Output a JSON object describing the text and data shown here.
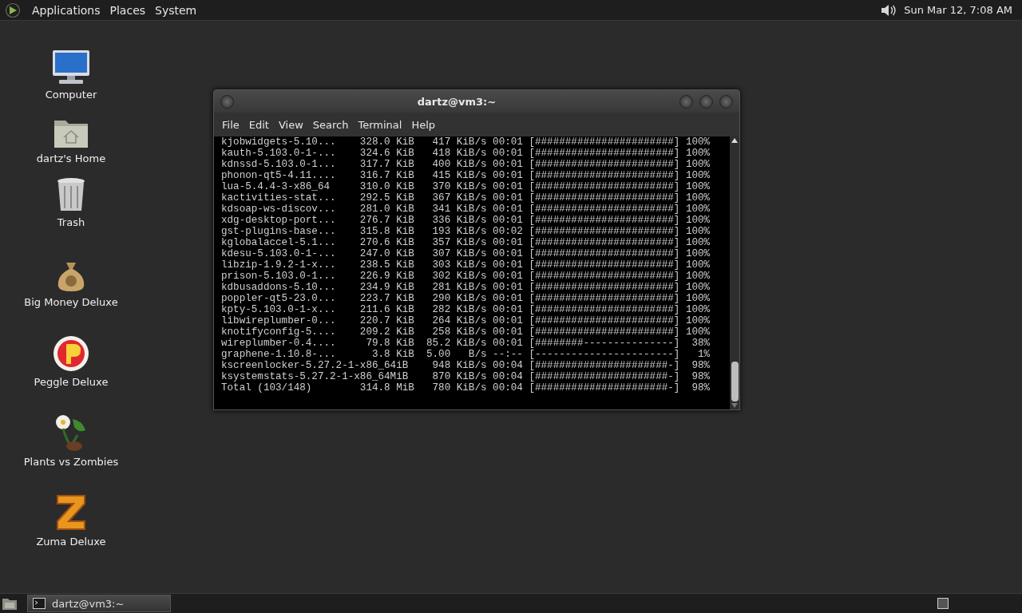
{
  "top_panel": {
    "menus": [
      "Applications",
      "Places",
      "System"
    ],
    "clock": "Sun Mar 12, 7:08 AM"
  },
  "desktop_icons": [
    {
      "label": "Computer",
      "kind": "computer"
    },
    {
      "label": "dartz's Home",
      "kind": "home"
    },
    {
      "label": "Trash",
      "kind": "trash"
    },
    {
      "label": "Big Money Deluxe",
      "kind": "money"
    },
    {
      "label": "Peggle Deluxe",
      "kind": "peggle"
    },
    {
      "label": "Plants vs Zombies",
      "kind": "plant"
    },
    {
      "label": "Zuma Deluxe",
      "kind": "zuma"
    }
  ],
  "window": {
    "title": "dartz@vm3:~",
    "menu": [
      "File",
      "Edit",
      "View",
      "Search",
      "Terminal",
      "Help"
    ],
    "terminal_lines": [
      "kjobwidgets-5.10...    328.0 KiB   417 KiB/s 00:01 [#######################] 100%",
      "kauth-5.103.0-1-...    324.6 KiB   418 KiB/s 00:01 [#######################] 100%",
      "kdnssd-5.103.0-1...    317.7 KiB   400 KiB/s 00:01 [#######################] 100%",
      "phonon-qt5-4.11....    316.7 KiB   415 KiB/s 00:01 [#######################] 100%",
      "lua-5.4.4-3-x86_64     310.0 KiB   370 KiB/s 00:01 [#######################] 100%",
      "kactivities-stat...    292.5 KiB   367 KiB/s 00:01 [#######################] 100%",
      "kdsoap-ws-discov...    281.0 KiB   341 KiB/s 00:01 [#######################] 100%",
      "xdg-desktop-port...    276.7 KiB   336 KiB/s 00:01 [#######################] 100%",
      "gst-plugins-base...    315.8 KiB   193 KiB/s 00:02 [#######################] 100%",
      "kglobalaccel-5.1...    270.6 KiB   357 KiB/s 00:01 [#######################] 100%",
      "kdesu-5.103.0-1-...    247.0 KiB   307 KiB/s 00:01 [#######################] 100%",
      "libzip-1.9.2-1-x...    238.5 KiB   303 KiB/s 00:01 [#######################] 100%",
      "prison-5.103.0-1...    226.9 KiB   302 KiB/s 00:01 [#######################] 100%",
      "kdbusaddons-5.10...    234.9 KiB   281 KiB/s 00:01 [#######################] 100%",
      "poppler-qt5-23.0...    223.7 KiB   290 KiB/s 00:01 [#######################] 100%",
      "kpty-5.103.0-1-x...    211.6 KiB   282 KiB/s 00:01 [#######################] 100%",
      "libwireplumber-0...    220.7 KiB   264 KiB/s 00:01 [#######################] 100%",
      "knotifyconfig-5....    209.2 KiB   258 KiB/s 00:01 [#######################] 100%",
      "wireplumber-0.4....     79.8 KiB  85.2 KiB/s 00:01 [########---------------]  38%",
      "graphene-1.10.8-...      3.8 KiB  5.00   B/s --:-- [-----------------------]   1%",
      "kscreenlocker-5.27.2-1-x86_64iB    948 KiB/s 00:04 [######################-]  98%",
      "ksystemstats-5.27.2-1-x86_64MiB    870 KiB/s 00:04 [######################-]  98%",
      "Total (103/148)        314.8 MiB   780 KiB/s 00:04 [######################-]  98%"
    ]
  },
  "taskbar": {
    "tasks": [
      {
        "label": "dartz@vm3:~",
        "selected": true
      }
    ]
  }
}
